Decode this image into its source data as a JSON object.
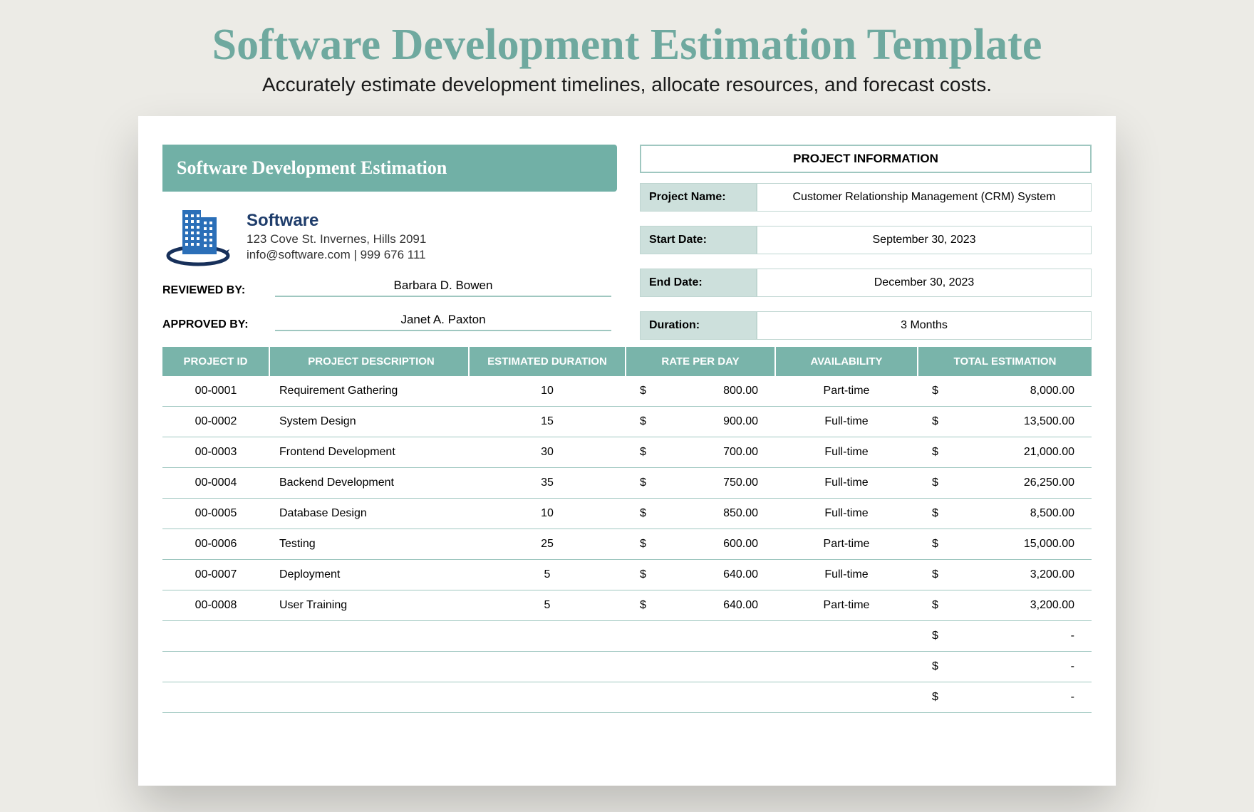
{
  "page": {
    "title": "Software Development Estimation Template",
    "subtitle": "Accurately estimate development timelines, allocate resources, and forecast costs."
  },
  "sheet": {
    "title_bar": "Software Development Estimation",
    "company": {
      "name": "Software",
      "address": "123 Cove St. Invernes, Hills 2091",
      "contact": "info@software.com | 999 676 111"
    },
    "reviewed_label": "REVIEWED BY:",
    "reviewed_value": "Barbara D. Bowen",
    "approved_label": "APPROVED BY:",
    "approved_value": "Janet A. Paxton",
    "project_info_header": "PROJECT INFORMATION",
    "info": {
      "project_name_label": "Project Name:",
      "project_name_value": "Customer Relationship Management (CRM) System",
      "start_label": "Start Date:",
      "start_value": "September 30, 2023",
      "end_label": "End Date:",
      "end_value": "December 30, 2023",
      "duration_label": "Duration:",
      "duration_value": "3 Months"
    },
    "table": {
      "headers": {
        "id": "PROJECT ID",
        "desc": "PROJECT DESCRIPTION",
        "dur": "ESTIMATED DURATION",
        "rate": "RATE PER DAY",
        "avail": "AVAILABILITY",
        "total": "TOTAL ESTIMATION"
      },
      "currency": "$",
      "rows": [
        {
          "id": "00-0001",
          "desc": "Requirement Gathering",
          "dur": "10",
          "rate": "800.00",
          "avail": "Part-time",
          "total": "8,000.00"
        },
        {
          "id": "00-0002",
          "desc": "System Design",
          "dur": "15",
          "rate": "900.00",
          "avail": "Full-time",
          "total": "13,500.00"
        },
        {
          "id": "00-0003",
          "desc": "Frontend Development",
          "dur": "30",
          "rate": "700.00",
          "avail": "Full-time",
          "total": "21,000.00"
        },
        {
          "id": "00-0004",
          "desc": "Backend Development",
          "dur": "35",
          "rate": "750.00",
          "avail": "Full-time",
          "total": "26,250.00"
        },
        {
          "id": "00-0005",
          "desc": "Database Design",
          "dur": "10",
          "rate": "850.00",
          "avail": "Full-time",
          "total": "8,500.00"
        },
        {
          "id": "00-0006",
          "desc": "Testing",
          "dur": "25",
          "rate": "600.00",
          "avail": "Part-time",
          "total": "15,000.00"
        },
        {
          "id": "00-0007",
          "desc": "Deployment",
          "dur": "5",
          "rate": "640.00",
          "avail": "Full-time",
          "total": "3,200.00"
        },
        {
          "id": "00-0008",
          "desc": "User Training",
          "dur": "5",
          "rate": "640.00",
          "avail": "Part-time",
          "total": "3,200.00"
        }
      ],
      "empty_rows": [
        {
          "total": "-"
        },
        {
          "total": "-"
        },
        {
          "total": "-"
        }
      ]
    }
  }
}
